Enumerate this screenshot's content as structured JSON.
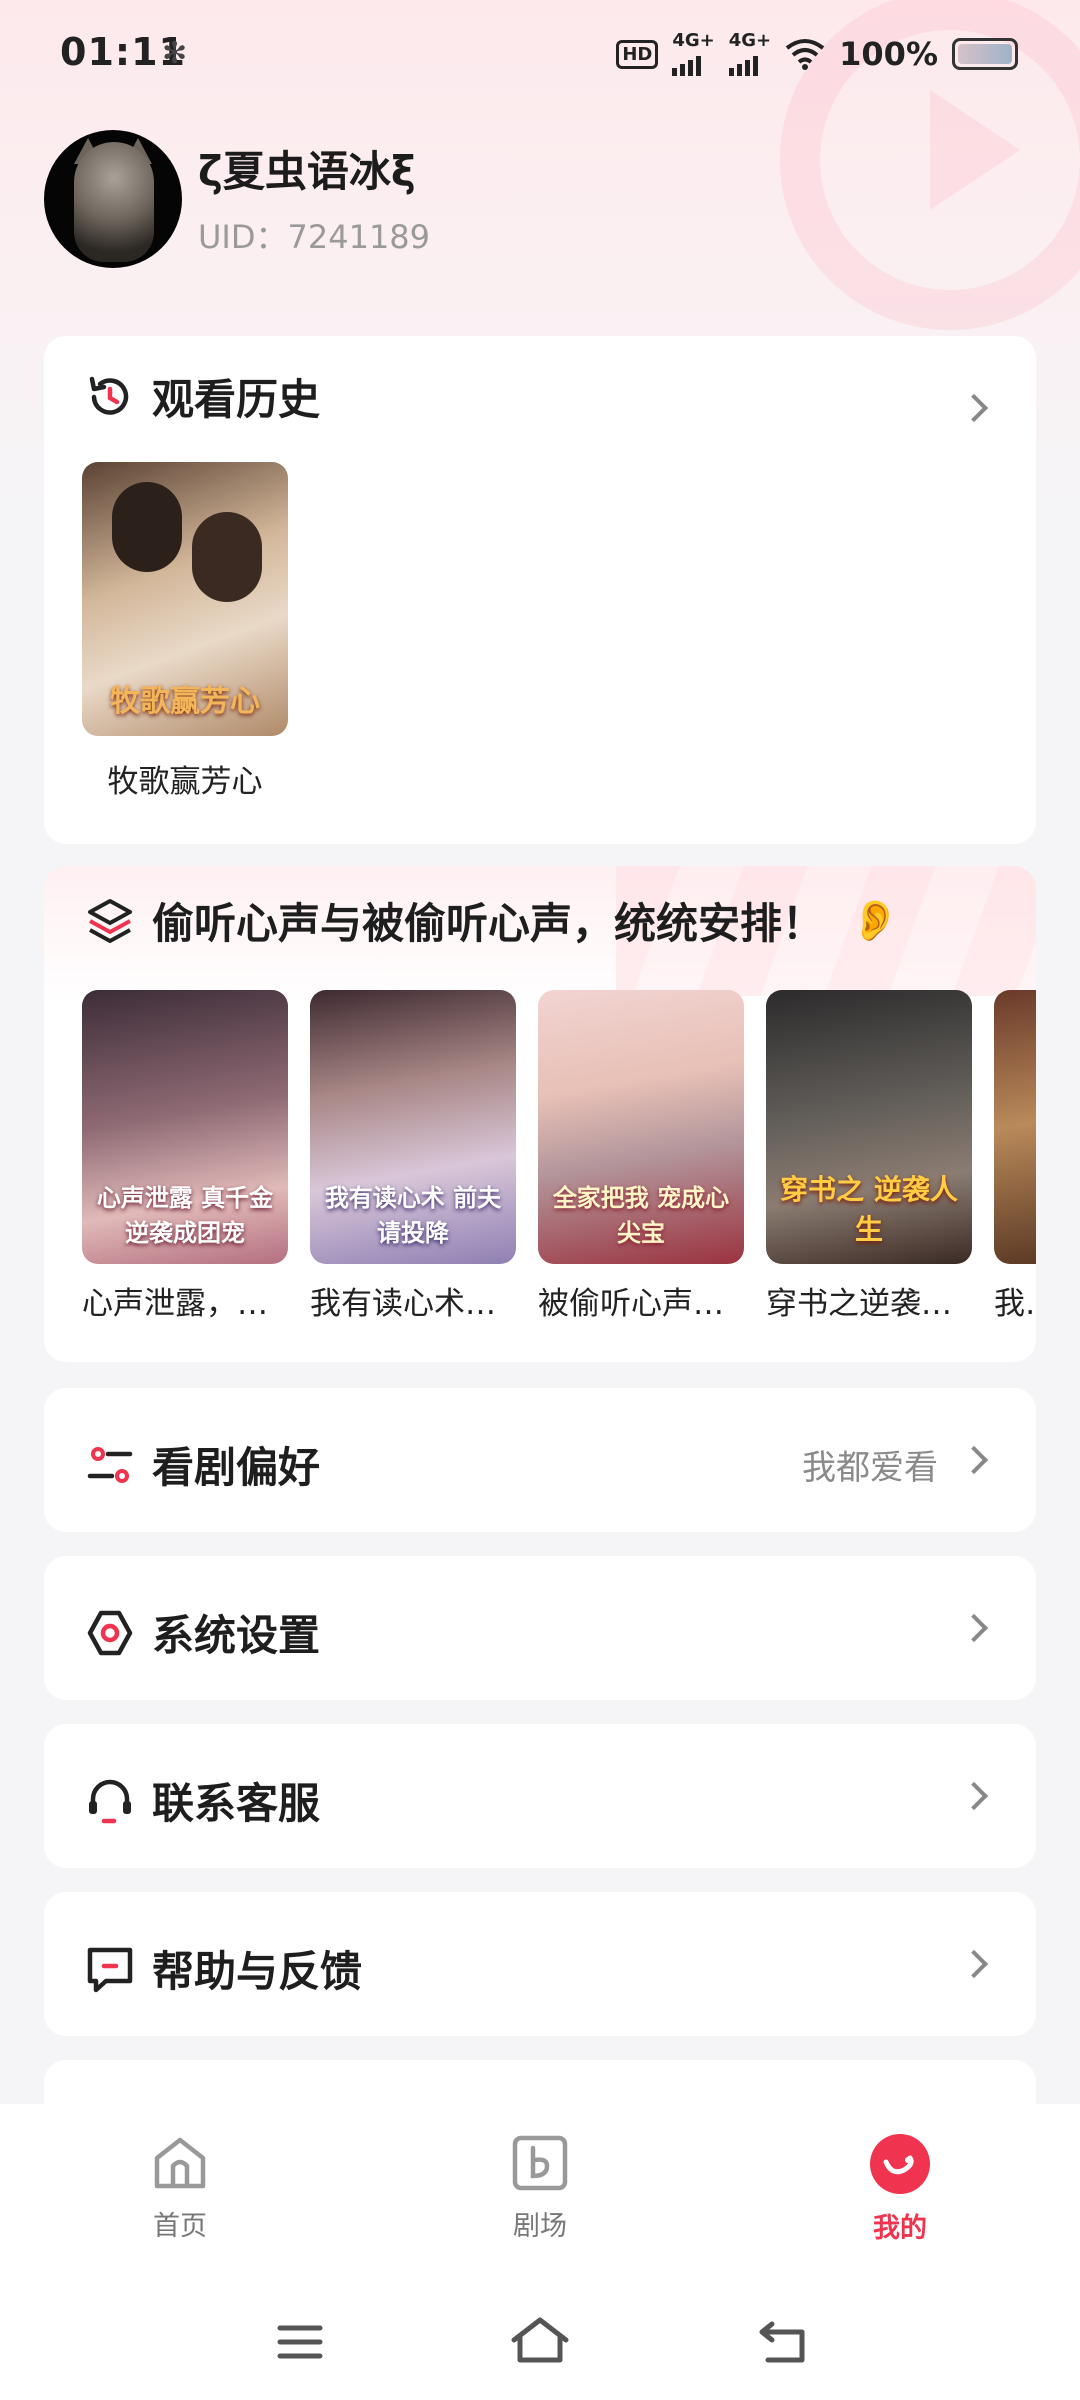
{
  "status_bar": {
    "time": "01:11",
    "time_icon": "✻",
    "hd_label": "HD",
    "net1": "4G+",
    "net2": "4G+",
    "battery": "100%"
  },
  "profile": {
    "username": "ζ夏虫语冰ξ",
    "uid": "UID：7241189",
    "avatar_icon": "cat-avatar"
  },
  "history": {
    "title": "观看历史",
    "items": [
      {
        "title": "牧歌赢芳心",
        "poster_text": "牧歌赢芳心"
      }
    ]
  },
  "topic": {
    "title": "偷听心声与被偷听心声，统统安排！",
    "emoji": "👂",
    "items": [
      {
        "title": "心声泄露，…",
        "poster_text": "心声泄露 真千金逆袭成团宠"
      },
      {
        "title": "我有读心术…",
        "poster_text": "我有读心术 前夫请投降"
      },
      {
        "title": "被偷听心声…",
        "poster_text": "全家把我 宠成心尖宝"
      },
      {
        "title": "穿书之逆袭…",
        "poster_text": "穿书之 逆袭人生"
      },
      {
        "title": "我…",
        "poster_text": ""
      }
    ]
  },
  "menu": [
    {
      "label": "看剧偏好",
      "value": "我都爱看",
      "icon": "preference-icon"
    },
    {
      "label": "系统设置",
      "value": "",
      "icon": "settings-icon"
    },
    {
      "label": "联系客服",
      "value": "",
      "icon": "headset-icon"
    },
    {
      "label": "帮助与反馈",
      "value": "",
      "icon": "feedback-icon"
    }
  ],
  "nav": [
    {
      "label": "首页",
      "icon": "home-icon",
      "active": false
    },
    {
      "label": "剧场",
      "icon": "theater-icon",
      "active": false
    },
    {
      "label": "我的",
      "icon": "me-icon",
      "active": true
    }
  ],
  "colors": {
    "accent": "#f0344f",
    "bg": "#f5f5f7",
    "card": "#ffffff"
  }
}
